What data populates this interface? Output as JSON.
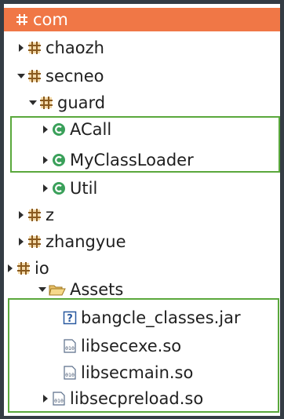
{
  "tree": {
    "items": [
      {
        "label": "com",
        "icon": "package-icon",
        "expanded": true,
        "selected": true
      },
      {
        "label": "chaozh",
        "icon": "package-icon",
        "expanded": false
      },
      {
        "label": "secneo",
        "icon": "package-icon",
        "expanded": true
      },
      {
        "label": "guard",
        "icon": "package-icon",
        "expanded": true
      },
      {
        "label": "ACall",
        "icon": "class-icon",
        "expanded": false
      },
      {
        "label": "MyClassLoader",
        "icon": "class-icon",
        "expanded": false
      },
      {
        "label": "Util",
        "icon": "class-icon",
        "expanded": false
      },
      {
        "label": "z",
        "icon": "package-icon",
        "expanded": false
      },
      {
        "label": "zhangyue",
        "icon": "package-icon",
        "expanded": false
      },
      {
        "label": "io",
        "icon": "package-icon",
        "expanded": false
      },
      {
        "label": "Assets",
        "icon": "folder-open-icon",
        "expanded": true
      },
      {
        "label": "bangcle_classes.jar",
        "icon": "unknown-file-icon"
      },
      {
        "label": "libsecexe.so",
        "icon": "binary-file-icon"
      },
      {
        "label": "libsecmain.so",
        "icon": "binary-file-icon"
      },
      {
        "label": "libsecpreload.so",
        "icon": "binary-file-icon",
        "expanded": false
      }
    ]
  },
  "colors": {
    "selection": "#f07746",
    "highlight_border": "#5aa83c",
    "background": "#343c44"
  }
}
